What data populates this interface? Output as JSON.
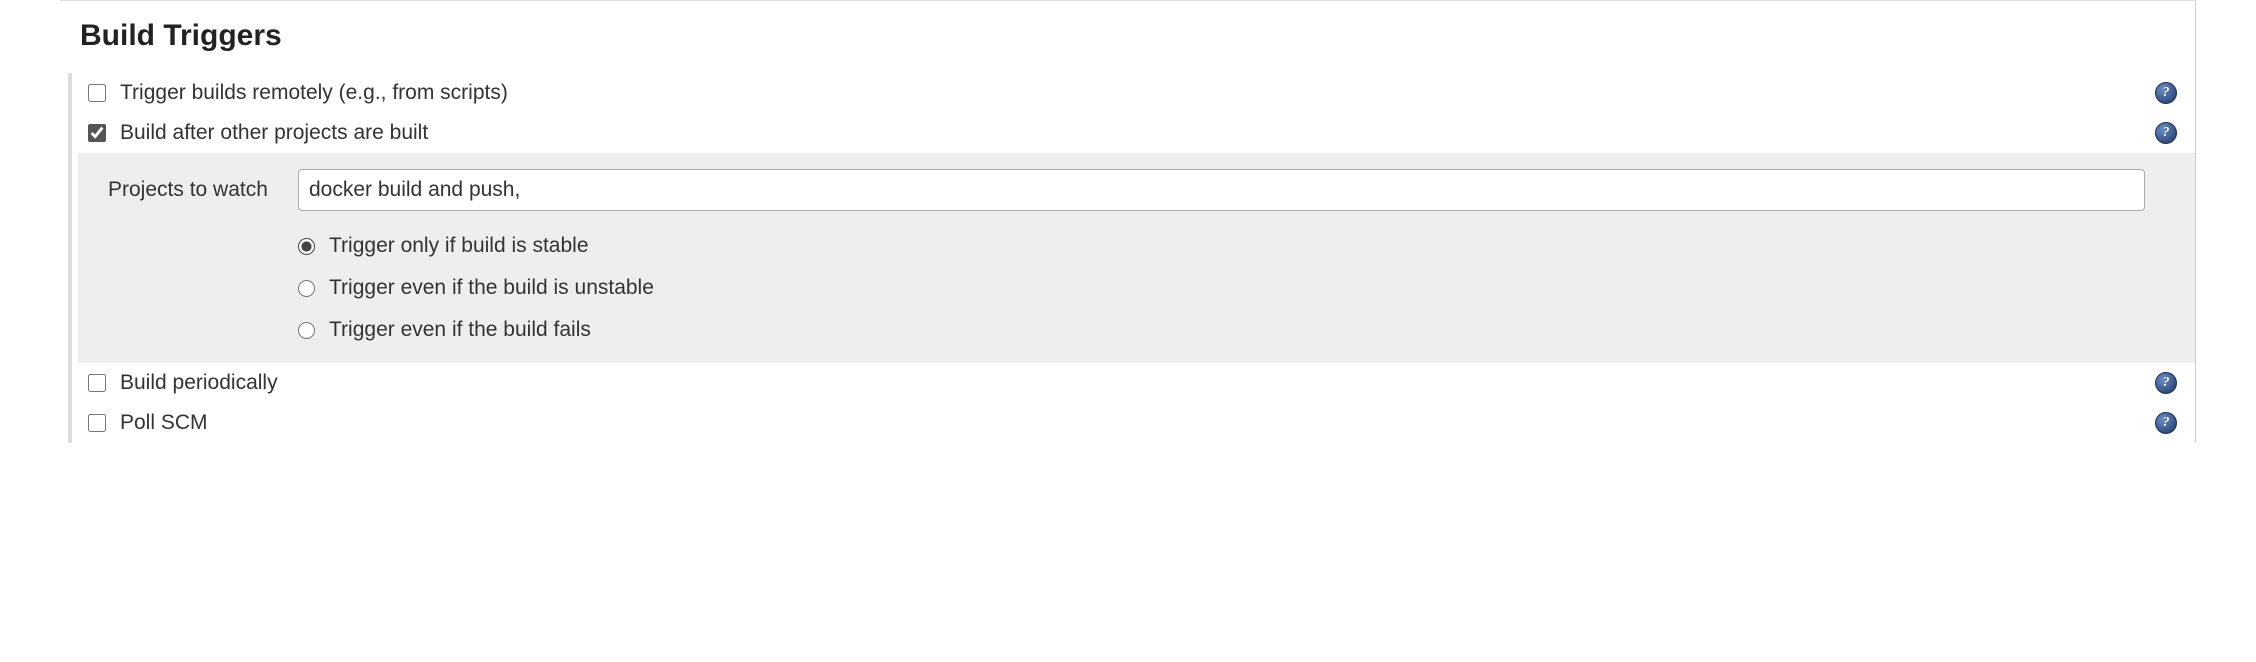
{
  "section": {
    "title": "Build Triggers"
  },
  "triggers": {
    "remote": {
      "checked": false,
      "label": "Trigger builds remotely (e.g., from scripts)"
    },
    "upstream": {
      "checked": true,
      "label": "Build after other projects are built",
      "projects_label": "Projects to watch",
      "projects_value": "docker build and push,",
      "threshold": {
        "selected": 0,
        "options": [
          "Trigger only if build is stable",
          "Trigger even if the build is unstable",
          "Trigger even if the build fails"
        ]
      }
    },
    "periodic": {
      "checked": false,
      "label": "Build periodically"
    },
    "poll_scm": {
      "checked": false,
      "label": "Poll SCM"
    }
  },
  "help_glyph": "?"
}
